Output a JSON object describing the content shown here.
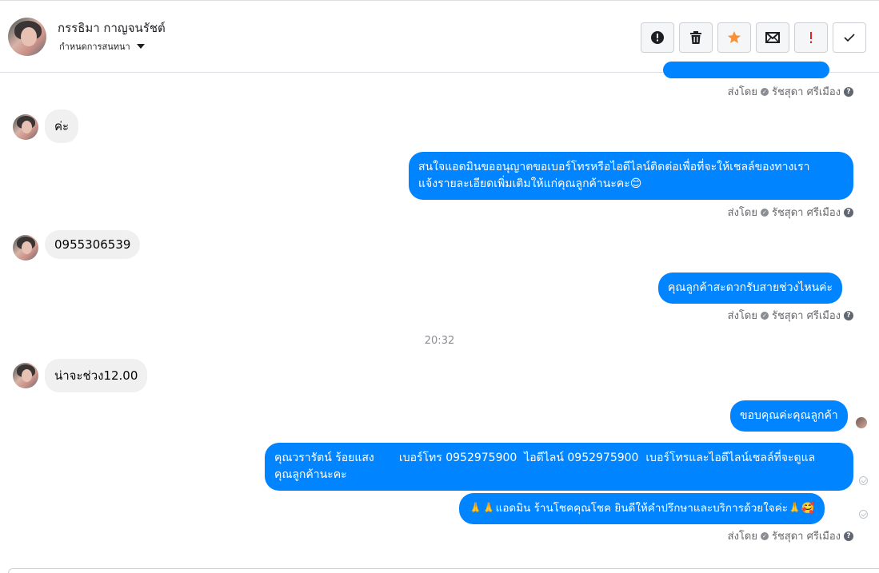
{
  "header": {
    "contact_name": "กรรธิมา กาญจนรัชต์",
    "conversation_menu": "กำหนดการสนทนา",
    "actions": [
      {
        "icon": "alert-circle-icon",
        "color": "#1c1e21"
      },
      {
        "icon": "trash-icon",
        "color": "#1c1e21"
      },
      {
        "icon": "star-icon",
        "color": "#f7923a"
      },
      {
        "icon": "envelope-icon",
        "color": "#1c1e21"
      },
      {
        "icon": "exclamation-icon",
        "color": "#e02424"
      },
      {
        "icon": "checkmark-icon",
        "color": "#1c1e21"
      }
    ]
  },
  "sent_by_label": "ส่งโดย",
  "sent_by_name": "รัชสุดา ศรีเมือง",
  "help_glyph": "?",
  "messages": {
    "m1": "ค่ะ",
    "m2_line1": "สนใจแอดมินขออนุญาตขอเบอร์โทรหรือไอดีไลน์ติดต่อเพื่อที่จะให้เชลล์ของทางเรา",
    "m2_line2": "แจ้งรายละเอียดเพิ่มเติมให้แก่คุณลูกค้านะคะ😊",
    "m3": "0955306539",
    "m4": "คุณลูกค้าสะดวกรับสายช่วงไหนค่ะ",
    "timestamp": "20:32",
    "m5": "น่าจะช่วง12.00",
    "m6": "ขอบคุณค่ะคุณลูกค้า",
    "m7_line1": "คุณวรารัตน์ ร้อยแสง       เบอร์โทร 0952975900  ไอดีไลน์ 0952975900  เบอร์โทรและไอดีไลน์เชลล์ที่จะดูแล",
    "m7_line2": "คุณลูกค้านะคะ",
    "m8": "🙏🙏แอดมิน ร้านโชคคุณโชค ยินดีให้คำปรึกษาและบริการด้วยใจค่ะ🙏🥰"
  },
  "colors": {
    "outgoing_bubble": "#0084ff",
    "incoming_bubble": "#f0f0f0"
  }
}
